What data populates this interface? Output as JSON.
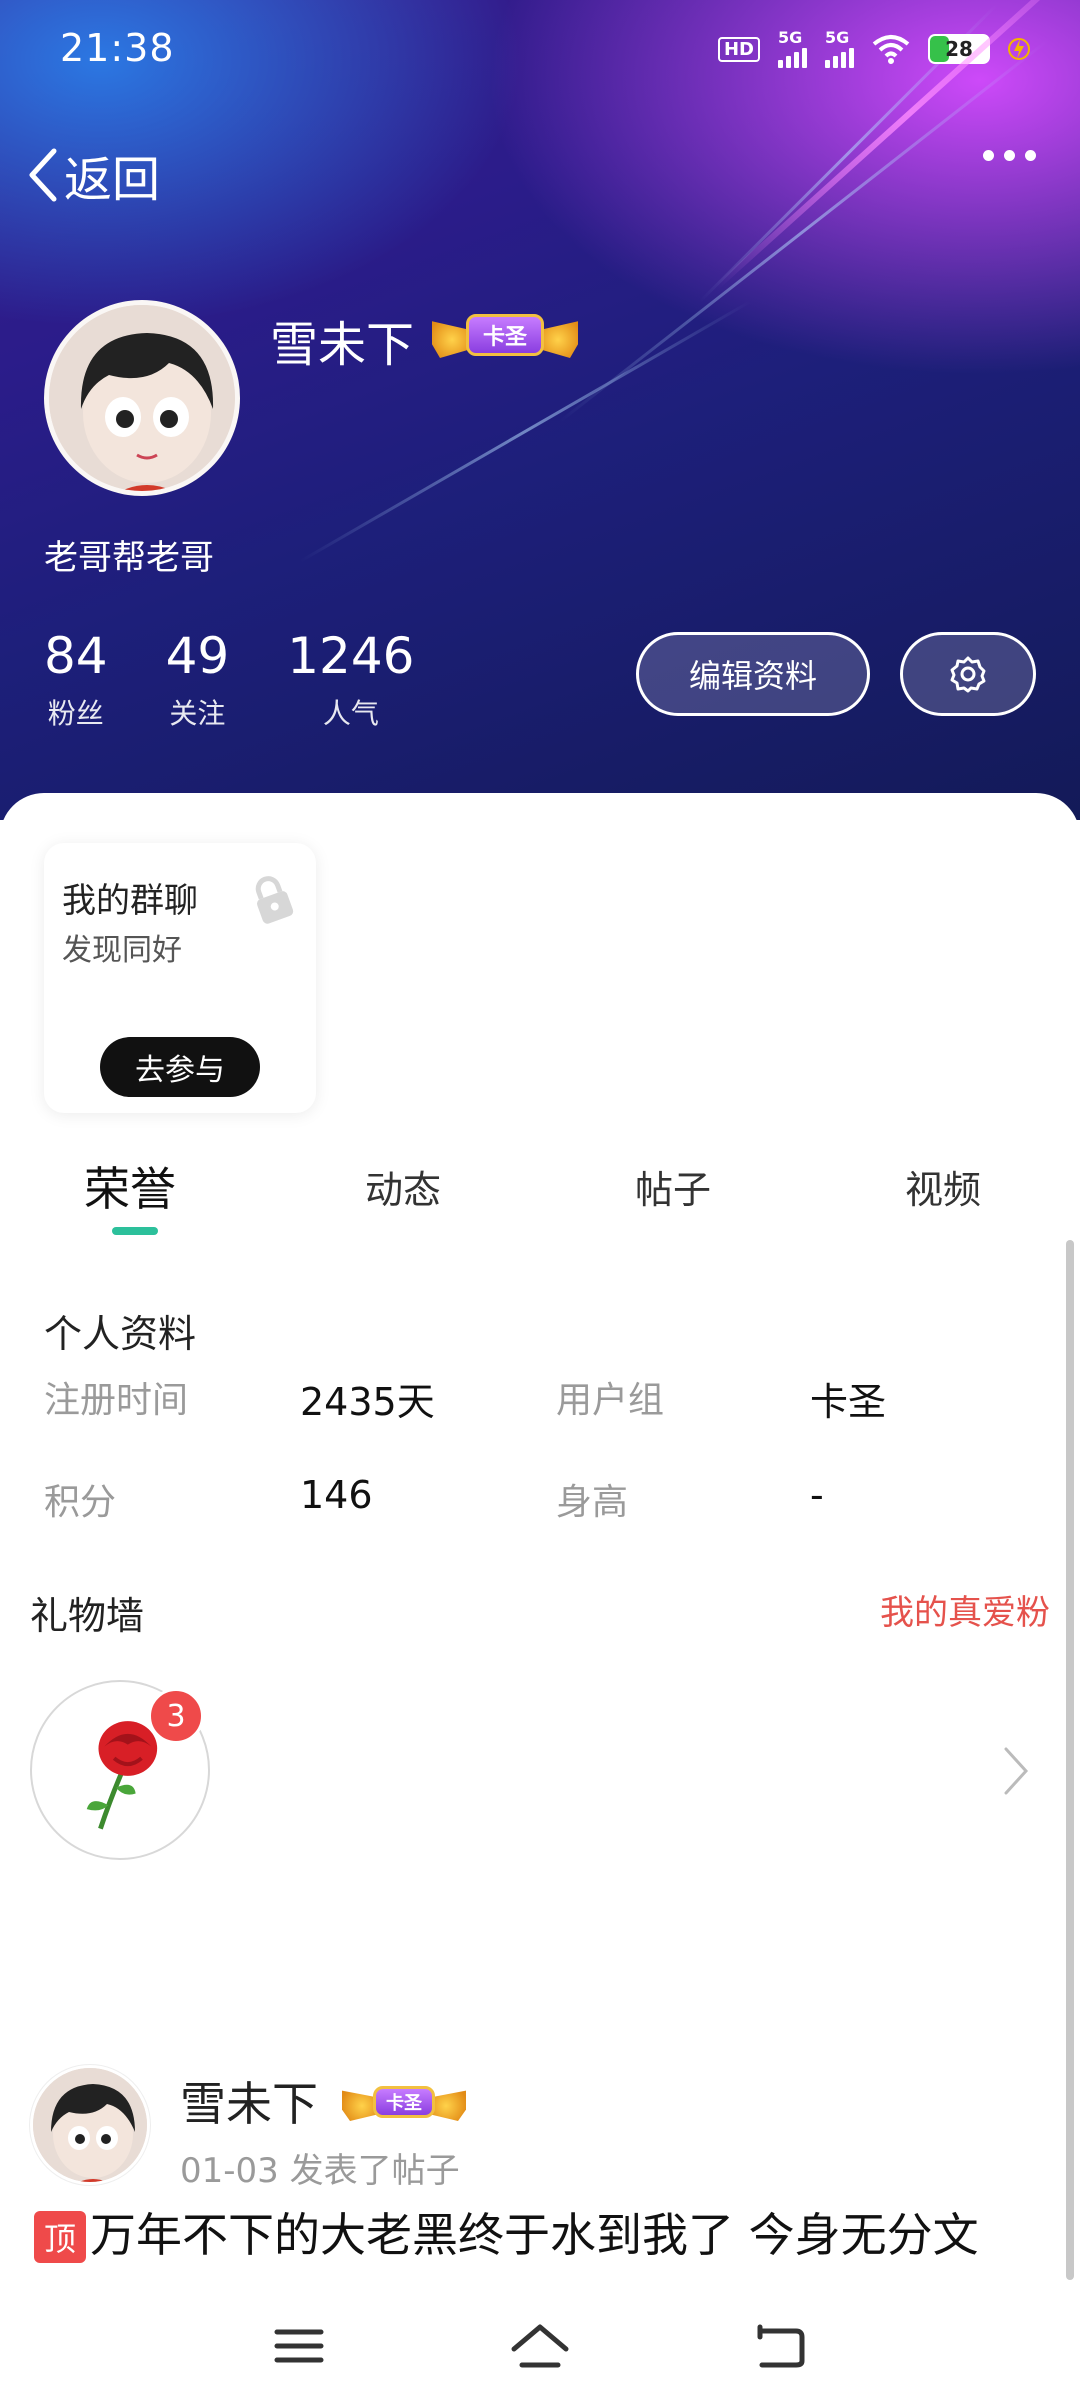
{
  "status_bar": {
    "time": "21:38",
    "network_1": "5G",
    "network_2": "5G",
    "hd_label": "HD",
    "battery": "28"
  },
  "header": {
    "back_label": "返回"
  },
  "profile": {
    "username": "雪未下",
    "badge_label": "卡圣",
    "signature": "老哥帮老哥",
    "stats": [
      {
        "value": "84",
        "label": "粉丝"
      },
      {
        "value": "49",
        "label": "关注"
      },
      {
        "value": "1246",
        "label": "人气"
      }
    ],
    "edit_button": "编辑资料"
  },
  "group_card": {
    "title": "我的群聊",
    "subtitle": "发现同好",
    "button": "去参与"
  },
  "tabs": [
    "荣誉",
    "动态",
    "帖子",
    "视频"
  ],
  "personal_info": {
    "title": "个人资料",
    "fields": [
      {
        "label": "注册时间",
        "value": "2435天"
      },
      {
        "label": "用户组",
        "value": "卡圣"
      },
      {
        "label": "积分",
        "value": "146"
      },
      {
        "label": "身高",
        "value": "-"
      }
    ]
  },
  "gift_wall": {
    "title": "礼物墙",
    "link": "我的真爱粉",
    "gift_count": "3"
  },
  "post": {
    "author": "雪未下",
    "badge_label": "卡圣",
    "meta": "01-03 发表了帖子",
    "pin_label": "顶",
    "text": "万年不下的大老黑终于水到我了 今身无分文"
  },
  "colors": {
    "accent": "#2cc09b",
    "link_red": "#e5524c",
    "badge_red": "#ef4a4a"
  }
}
